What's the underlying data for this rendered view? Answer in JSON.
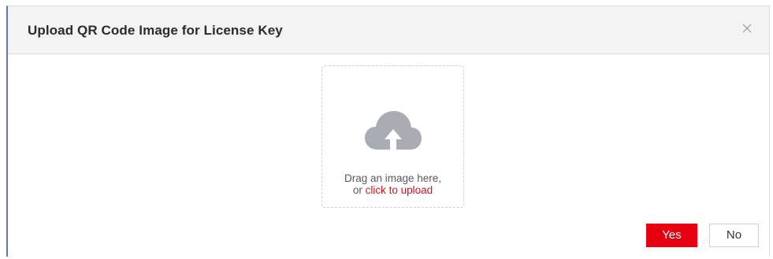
{
  "dialog": {
    "title": "Upload QR Code Image for License Key",
    "close_icon": "close-icon"
  },
  "upload": {
    "icon": "cloud-upload-icon",
    "line1": "Drag an image here,",
    "line2_prefix": "or ",
    "line2_link": "click to upload"
  },
  "buttons": {
    "yes_label": "Yes",
    "no_label": "No"
  },
  "colors": {
    "accent": "#e60012",
    "link": "#d6101c",
    "header_bg": "#f3f3f3",
    "icon_gray": "#a9adb3"
  }
}
